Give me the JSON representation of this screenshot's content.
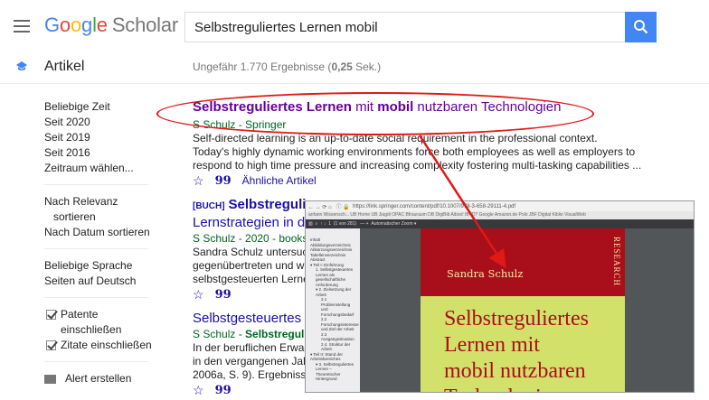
{
  "header": {
    "logo_google": [
      "G",
      "o",
      "o",
      "g",
      "l",
      "e"
    ],
    "logo_scholar": "Scholar",
    "search_value": "Selbstreguliertes Lernen mobil"
  },
  "subheader": {
    "tab_label": "Artikel",
    "result_count_prefix": "Ungefähr 1.770 Ergebnisse (",
    "result_count_time": "0,25",
    "result_count_suffix": " Sek.)"
  },
  "sidebar": {
    "time_heading": "Beliebige Zeit",
    "time_items": [
      "Seit 2020",
      "Seit 2019",
      "Seit 2016",
      "Zeitraum wählen..."
    ],
    "sort_heading_1": "Nach Relevanz",
    "sort_heading_2": "sortieren",
    "sort_date": "Nach Datum sortieren",
    "lang_heading": "Beliebige Sprache",
    "lang_de": "Seiten auf Deutsch",
    "patents_1": "Patente",
    "patents_2": "einschließen",
    "citations": "Zitate einschließen",
    "alert": "Alert erstellen"
  },
  "results": [
    {
      "title_b1": "Selbstreguliertes Lernen",
      "title_t1": " mit ",
      "title_b2": "mobil",
      "title_t2": " nutzbaren Technologien",
      "meta": "S Schulz - Springer",
      "snippet": [
        "Self-directed learning is an up-to-date social requirement in the professional context.",
        "Today's highly dynamic working environments force both employees as well as employers to",
        "respond to high time pressure and increasing complexity fostering multi-tasking capabilities ..."
      ],
      "related": "Ähnliche Artikel"
    },
    {
      "tag": "[BUCH]",
      "title_b1": "Selbstreguli",
      "title_line2": "Lernstrategien in d",
      "meta_prefix": "S Schulz - 2020 - books",
      "snippet": [
        "Sandra Schulz untersuch",
        "gegenübertreten und wie",
        "selbstgesteuerten Lerner"
      ]
    },
    {
      "title": "Selbstgesteuertes",
      "meta_prefix": "S Schulz - ",
      "meta_bold": "Selbstreguli",
      "snippet": [
        "In der beruflichen Erwach",
        "in den vergangenen Jahre",
        "2006a, S. 9). Ergebnisse"
      ]
    }
  ],
  "pdf_viewer": {
    "url": "https://link.springer.com/content/pdf/10.1007/978-3-658-29111-4.pdf",
    "page_info": "(1 von 281)",
    "zoom": "Automatischer Zoom",
    "bookmarks": "anfann   Wissensch...   UB Home   UB Jiagdi OPAC   Bfrauraum   DB   DigiBib   Aiboo!   IB-ID?   Google   Amazon.de   Polo   JBF   Digital   Kiblio   VisualWeb",
    "outline": [
      {
        "text": "Inhalt",
        "level": 0
      },
      {
        "text": "Abbildungsverzeichnis",
        "level": 0
      },
      {
        "text": "Abkürzungsverzeichnis",
        "level": 0
      },
      {
        "text": "Tabellenverzeichnis",
        "level": 0
      },
      {
        "text": "Abstract",
        "level": 0
      },
      {
        "text": "▾ Teil I: Einführung",
        "level": 0
      },
      {
        "text": "1. Selbstgesteuertes",
        "level": 1
      },
      {
        "text": "Lernen als",
        "level": 1
      },
      {
        "text": "gesellschaftliche",
        "level": 1
      },
      {
        "text": "Anforderung",
        "level": 1
      },
      {
        "text": "▾ 2. Zielsetzung der",
        "level": 1
      },
      {
        "text": "Arbeit",
        "level": 1
      },
      {
        "text": "2.1",
        "level": 2
      },
      {
        "text": "Problemstellung",
        "level": 2
      },
      {
        "text": "und",
        "level": 2
      },
      {
        "text": "Forschungsbedarf",
        "level": 2
      },
      {
        "text": "2.2",
        "level": 2
      },
      {
        "text": "Forschungsinteresse",
        "level": 2
      },
      {
        "text": "und Ziel der Arbeit",
        "level": 2
      },
      {
        "text": "2.3",
        "level": 2
      },
      {
        "text": "Ausgangssituation",
        "level": 2
      },
      {
        "text": "2.4. Struktur der",
        "level": 2
      },
      {
        "text": "Arbeit",
        "level": 2
      },
      {
        "text": "▾ Teil II: Stand der",
        "level": 0
      },
      {
        "text": "Arbeitsbereiches",
        "level": 0
      },
      {
        "text": "▾ 3. Selbstreguliertes",
        "level": 1
      },
      {
        "text": "Lernen –",
        "level": 1
      },
      {
        "text": "Theoretischer",
        "level": 1
      },
      {
        "text": "Hintergrund",
        "level": 1
      }
    ],
    "cover_author": "Sandra Schulz",
    "cover_series": "RESEARCH",
    "cover_title": [
      "Selbstreguliertes",
      "Lernen mit",
      "mobil nutzbaren",
      "Technologien"
    ]
  },
  "colors": {
    "google_blue": "#4285f4",
    "link_purple": "#660099",
    "meta_green": "#006621",
    "annotation_red": "#e01818",
    "cover_red": "#a80f1a",
    "cover_yellow": "#d2e16a"
  }
}
